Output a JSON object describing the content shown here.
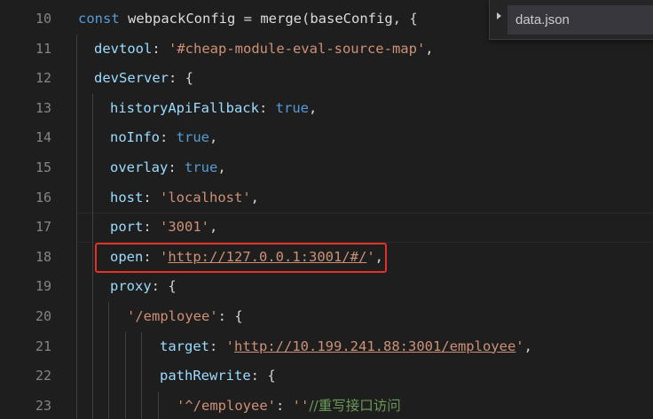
{
  "editor": {
    "lines": [
      {
        "number": "10",
        "tokens": [
          {
            "t": "const ",
            "c": "kw"
          },
          {
            "t": "webpackConfig",
            "c": "id"
          },
          {
            "t": " = ",
            "c": "punc"
          },
          {
            "t": "merge",
            "c": "id"
          },
          {
            "t": "(",
            "c": "punc"
          },
          {
            "t": "baseConfig",
            "c": "id"
          },
          {
            "t": ", {",
            "c": "punc"
          }
        ]
      },
      {
        "number": "11",
        "tokens": [
          {
            "t": "devtool",
            "c": "prop"
          },
          {
            "t": ": ",
            "c": "punc"
          },
          {
            "t": "'#cheap-module-eval-source-map'",
            "c": "str"
          },
          {
            "t": ",",
            "c": "punc"
          }
        ]
      },
      {
        "number": "12",
        "tokens": [
          {
            "t": "devServer",
            "c": "prop"
          },
          {
            "t": ": {",
            "c": "punc"
          }
        ]
      },
      {
        "number": "13",
        "tokens": [
          {
            "t": "historyApiFallback",
            "c": "prop"
          },
          {
            "t": ": ",
            "c": "punc"
          },
          {
            "t": "true",
            "c": "lit"
          },
          {
            "t": ",",
            "c": "punc"
          }
        ]
      },
      {
        "number": "14",
        "tokens": [
          {
            "t": "noInfo",
            "c": "prop"
          },
          {
            "t": ": ",
            "c": "punc"
          },
          {
            "t": "true",
            "c": "lit"
          },
          {
            "t": ",",
            "c": "punc"
          }
        ]
      },
      {
        "number": "15",
        "tokens": [
          {
            "t": "overlay",
            "c": "prop"
          },
          {
            "t": ": ",
            "c": "punc"
          },
          {
            "t": "true",
            "c": "lit"
          },
          {
            "t": ",",
            "c": "punc"
          }
        ]
      },
      {
        "number": "16",
        "tokens": [
          {
            "t": "host",
            "c": "prop"
          },
          {
            "t": ": ",
            "c": "punc"
          },
          {
            "t": "'localhost'",
            "c": "str"
          },
          {
            "t": ",",
            "c": "punc"
          }
        ]
      },
      {
        "number": "17",
        "tokens": [
          {
            "t": "port",
            "c": "prop"
          },
          {
            "t": ": ",
            "c": "punc"
          },
          {
            "t": "'3001'",
            "c": "str"
          },
          {
            "t": ",",
            "c": "punc"
          }
        ]
      },
      {
        "number": "18",
        "tokens": [
          {
            "t": "open",
            "c": "prop"
          },
          {
            "t": ": ",
            "c": "punc"
          },
          {
            "t": "'",
            "c": "str"
          },
          {
            "t": "http://127.0.0.1:3001/#/",
            "c": "str url"
          },
          {
            "t": "'",
            "c": "str"
          },
          {
            "t": ",",
            "c": "punc"
          }
        ]
      },
      {
        "number": "19",
        "tokens": [
          {
            "t": "proxy",
            "c": "prop"
          },
          {
            "t": ": {",
            "c": "punc"
          }
        ]
      },
      {
        "number": "20",
        "tokens": [
          {
            "t": "'/employee'",
            "c": "str"
          },
          {
            "t": ": {",
            "c": "punc"
          }
        ]
      },
      {
        "number": "21",
        "tokens": [
          {
            "t": "target",
            "c": "prop"
          },
          {
            "t": ": ",
            "c": "punc"
          },
          {
            "t": "'",
            "c": "str"
          },
          {
            "t": "http://10.199.241.88:3001/employee",
            "c": "str url"
          },
          {
            "t": "'",
            "c": "str"
          },
          {
            "t": ",",
            "c": "punc"
          }
        ]
      },
      {
        "number": "22",
        "tokens": [
          {
            "t": "pathRewrite",
            "c": "prop"
          },
          {
            "t": ": {",
            "c": "punc"
          }
        ]
      },
      {
        "number": "23",
        "tokens": [
          {
            "t": "'^/employee'",
            "c": "str"
          },
          {
            "t": ": ",
            "c": "punc"
          },
          {
            "t": "''",
            "c": "str"
          },
          {
            "t": "//重写接口访问",
            "c": "cmt"
          }
        ]
      }
    ]
  },
  "outline": {
    "file_name": "data.json"
  },
  "colors": {
    "highlight_box": "#e5302a",
    "background": "#1e1e1e"
  }
}
